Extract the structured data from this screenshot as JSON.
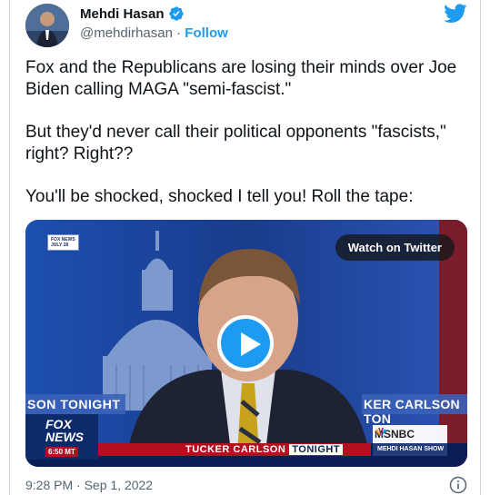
{
  "author": {
    "display_name": "Mehdi Hasan",
    "handle": "@mehdirhasan",
    "separator": "·",
    "follow_label": "Follow"
  },
  "tweet": {
    "paragraphs": [
      "Fox and the Republicans are losing their minds over Joe Biden calling MAGA \"semi-fascist.\"",
      "But they'd never call their political opponents \"fascists,\" right? Right??",
      "You'll be shocked, shocked I tell you! Roll the tape:"
    ]
  },
  "media": {
    "watch_label": "Watch on Twitter",
    "overlays": {
      "fox_news_badge": "FOX NEWS",
      "date_badge": "JULY 28",
      "lower_left_ticker": "SON TONIGHT",
      "lower_right_ticker": "KER CARLSON TON",
      "fox_logo_top": "FOX",
      "fox_logo_bottom": "NEWS",
      "time_badge": "6:50 MT",
      "show_banner": "TUCKER CARLSON",
      "show_banner_suffix": "TONIGHT",
      "msnbc_logo": "MSNBC",
      "msnbc_show": "MEHDI HASAN SHOW"
    }
  },
  "footer": {
    "timestamp": "9:28 PM · Sep 1, 2022"
  },
  "colors": {
    "twitter_blue": "#1d9bf0",
    "text_primary": "#0f1419",
    "text_secondary": "#536471"
  },
  "icons": {
    "verified": "verified-badge-icon",
    "twitter": "twitter-bird-icon",
    "play": "play-icon",
    "info": "info-icon"
  }
}
